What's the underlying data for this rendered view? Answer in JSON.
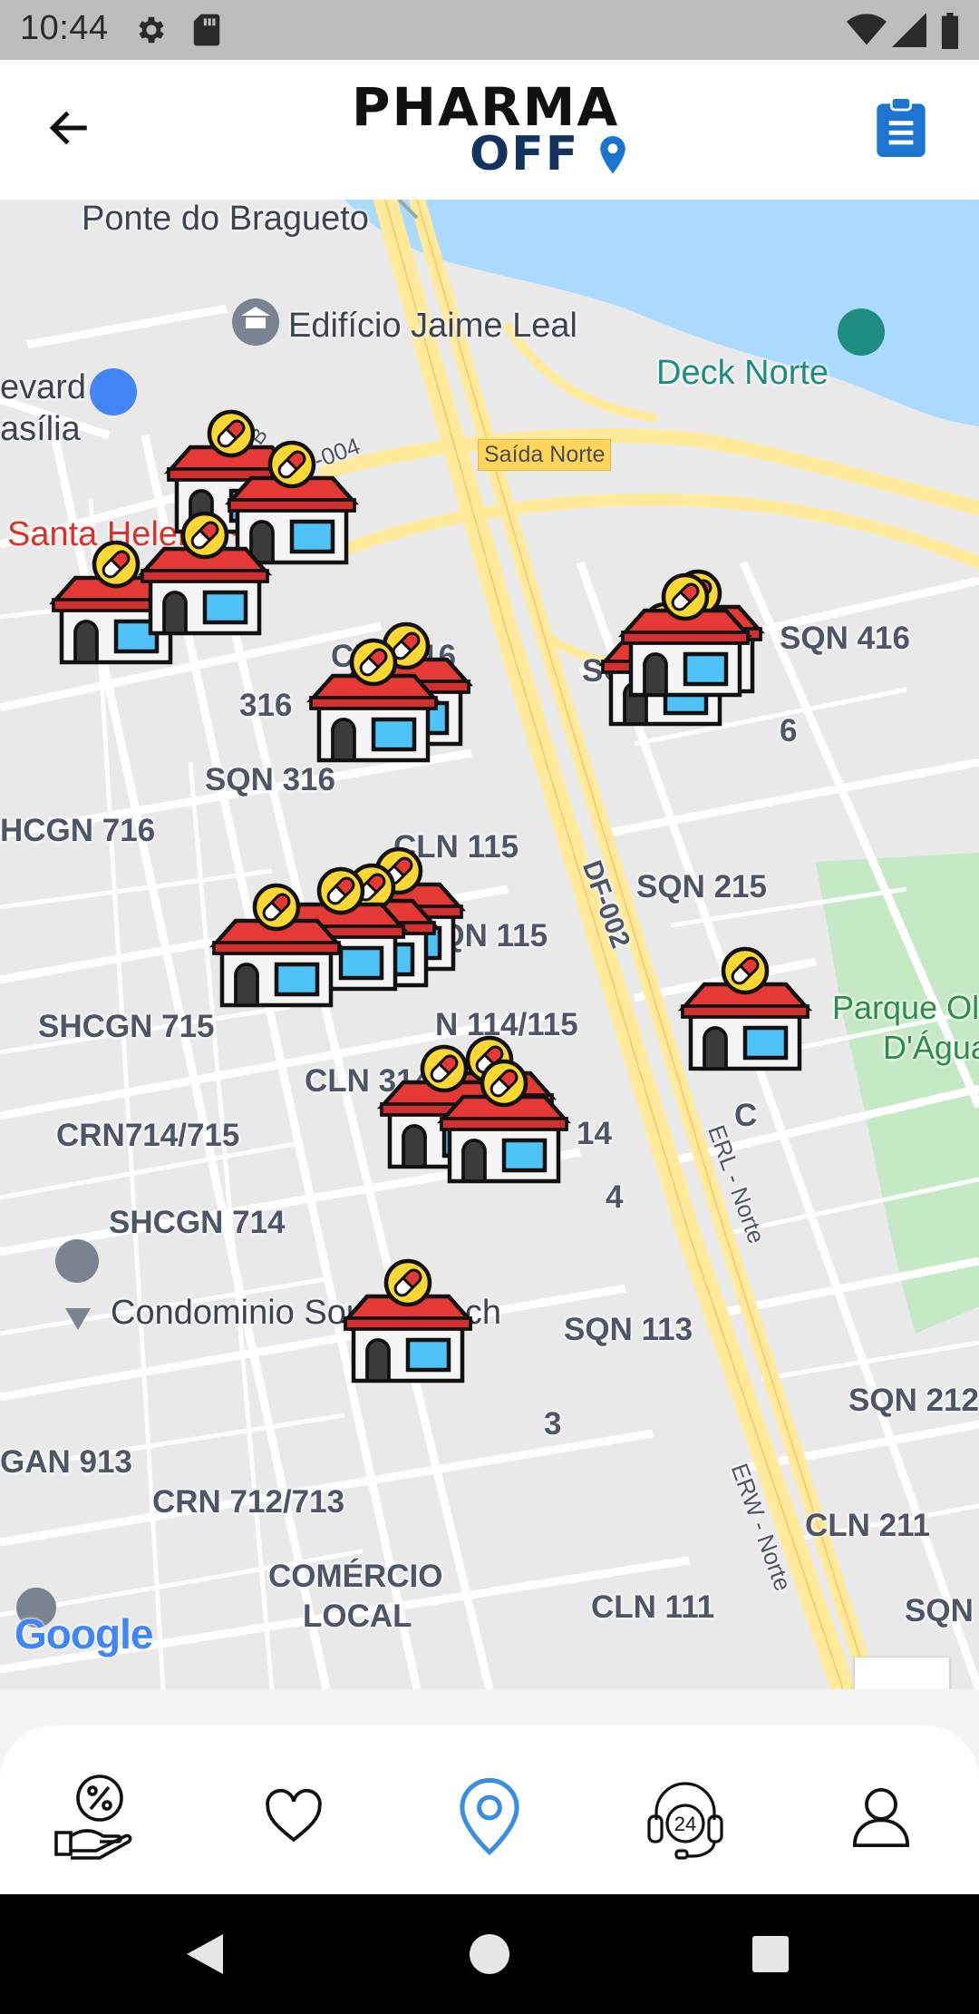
{
  "status_bar": {
    "time": "10:44"
  },
  "app_bar": {
    "logo_line1": "PHARMA",
    "logo_line2": "OFF"
  },
  "map": {
    "labels": {
      "ponte": "Ponte do Bragueto",
      "edificio": "Edifício Jaime Leal",
      "deck": "Deck Norte",
      "evard": "evard",
      "asilia": "asília",
      "df004": "DF-004",
      "pqeb": "PQEB",
      "saida": "Saída Norte",
      "santa_helena": "Santa Helena",
      "cln116": "CLN 116",
      "sqn416": "SQN 416",
      "sqn_partial": "SQN",
      "num316": "316",
      "sqn316": "SQN 316",
      "hcgn716": "HCGN 716",
      "cln115": "CLN 115",
      "sqn215": "SQN 215",
      "df002": "DF-002",
      "sqn115": "SQN 115",
      "n114": "N 114/115",
      "shcgn715": "SHCGN 715",
      "cln314": "CLN 314",
      "parque1": "Parque Ol",
      "parque2": "D'Água",
      "crn714": "CRN714/715",
      "erl": "ERL - Norte",
      "shcgn714": "SHCGN 714",
      "condominio": "Condominio South Beach",
      "sqn113": "SQN 113",
      "sqn212": "SQN 212",
      "gan913": "GAN 913",
      "crn712": "CRN 712/713",
      "erw": "ERW - Norte",
      "cln211": "CLN 211",
      "comercio": "COMÉRCIO",
      "local": "LOCAL",
      "cln111": "CLN 111",
      "sqn_right": "SQN",
      "num6": "6",
      "num4": "4",
      "num3": "3",
      "num14": "14",
      "c": "C",
      "google": "Google"
    },
    "zoom_in": "+",
    "zoom_out": "−"
  },
  "bottom_nav": {
    "items": [
      {
        "name": "discounts",
        "icon": "discount-hand-icon",
        "active": false
      },
      {
        "name": "favorites",
        "icon": "heart-icon",
        "active": false
      },
      {
        "name": "map",
        "icon": "location-pin-icon",
        "active": true
      },
      {
        "name": "support",
        "icon": "headset-24-icon",
        "active": false
      },
      {
        "name": "profile",
        "icon": "user-icon",
        "active": false
      }
    ]
  },
  "colors": {
    "brand_blue": "#1b75d0",
    "active_nav": "#3b8de0",
    "water": "#aadaff",
    "park": "#c5e8c5",
    "highway": "#ffe99a"
  }
}
